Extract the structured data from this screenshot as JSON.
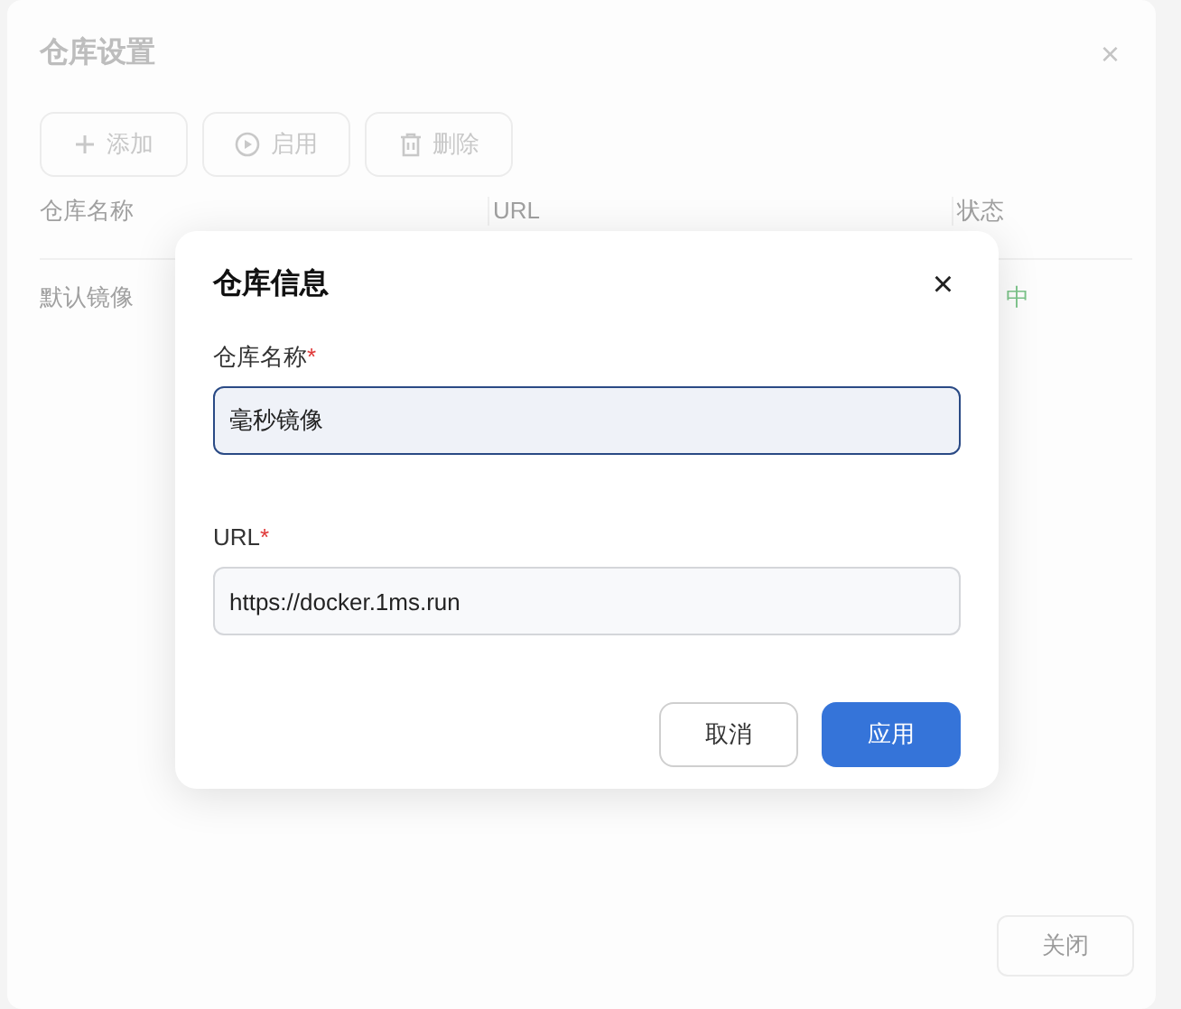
{
  "window": {
    "title": "仓库设置",
    "close": "×"
  },
  "toolbar": [
    {
      "label": "添加",
      "kind": "plus"
    },
    {
      "label": "启用",
      "kind": "play"
    },
    {
      "label": "删除",
      "kind": "trash"
    }
  ],
  "table": {
    "columns": [
      "仓库名称",
      "URL",
      "状态"
    ],
    "rows": [
      {
        "name": "默认镜像",
        "status": "中"
      }
    ]
  },
  "footer_button": "关闭",
  "dialog": {
    "title": "仓库信息",
    "close": "×",
    "fields": [
      {
        "label": "仓库名称",
        "required": "*",
        "value": "毫秒镜像",
        "focused": true
      },
      {
        "label": "URL",
        "required": "*",
        "value": "https://docker.1ms.run",
        "focused": false
      }
    ],
    "buttons": [
      {
        "label": "取消",
        "primary": false
      },
      {
        "label": "应用",
        "primary": true
      }
    ]
  }
}
